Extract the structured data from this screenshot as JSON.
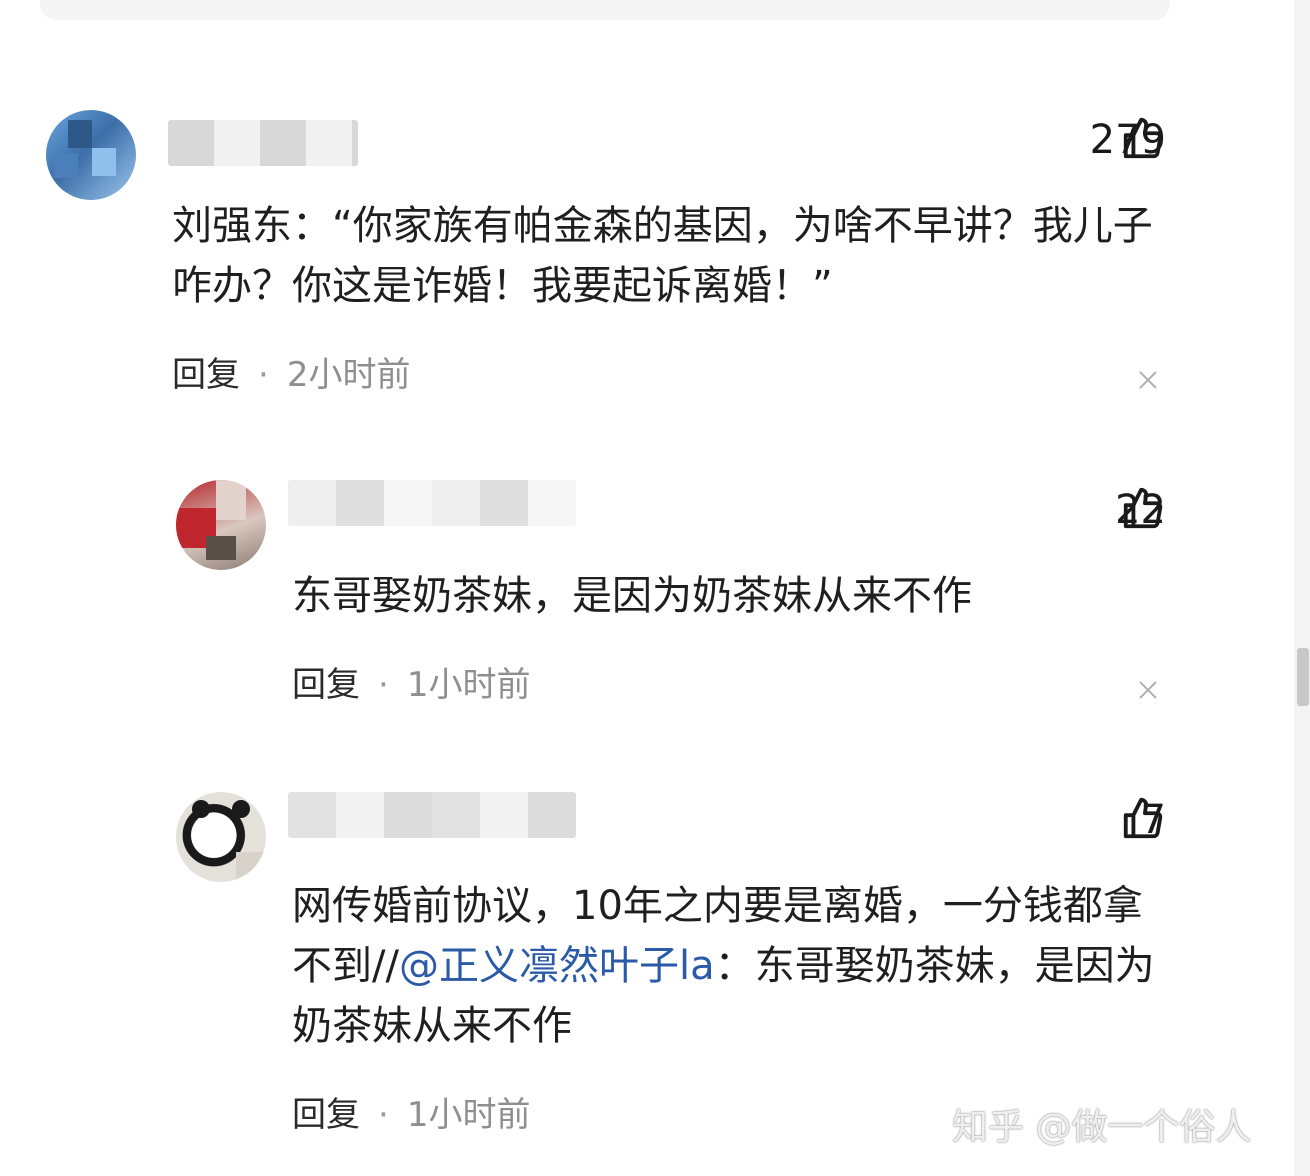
{
  "comments": [
    {
      "likes": "279",
      "text": "刘强东：“你家族有帕金森的基因，为啥不早讲？我儿子咋办？你这是诈婚！我要起诉离婚！”",
      "reply_label": "回复",
      "separator": "·",
      "time": "2小时前",
      "avatar_icon": "user-avatar",
      "like_icon": "thumbs-up-icon",
      "close_icon": "close-icon"
    },
    {
      "likes": "22",
      "text": "东哥娶奶茶妹，是因为奶茶妹从来不作",
      "reply_label": "回复",
      "separator": "·",
      "time": "1小时前"
    },
    {
      "likes": "7",
      "text_before": "网传婚前协议，10年之内要是离婚，一分钱都拿不到//",
      "mention": "@正义凛然叶子la",
      "text_after": "：东哥娶奶茶妹，是因为奶茶妹从来不作",
      "reply_label": "回复",
      "separator": "·",
      "time": "1小时前"
    }
  ],
  "watermark": "知乎 @做一个俗人",
  "colors": {
    "mention": "#2b5aa8",
    "time": "#8f8f8f",
    "text": "#1f1f1f"
  }
}
